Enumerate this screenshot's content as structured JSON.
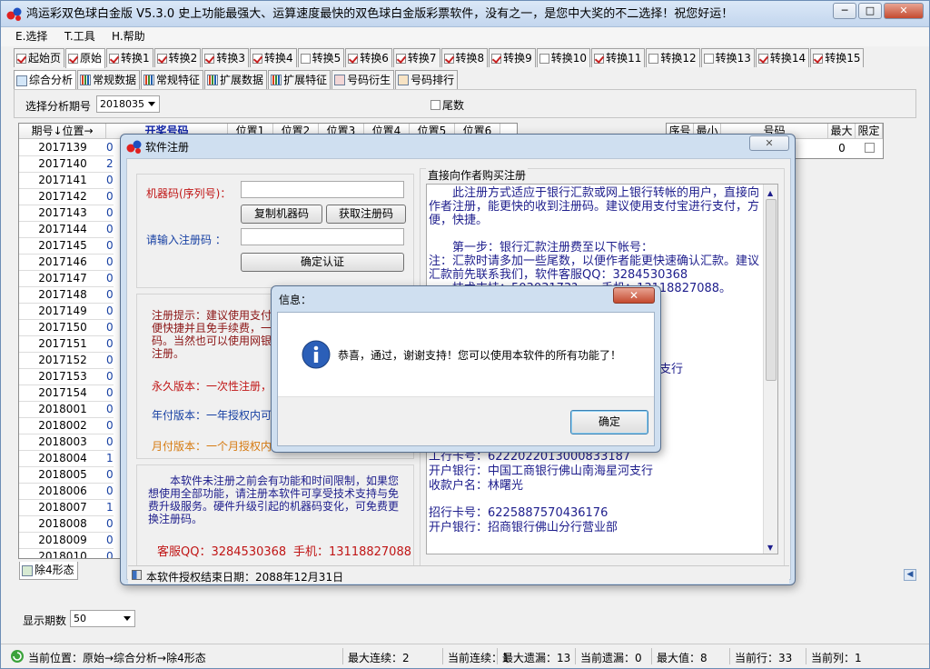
{
  "window": {
    "title": "鸿运彩双色球白金版 V5.3.0  史上功能最强大、运算速度最快的双色球白金版彩票软件，没有之一，是您中大奖的不二选择！祝您好运！"
  },
  "menu": [
    "E.选择",
    "T.工具",
    "H.帮助"
  ],
  "top_tabs": [
    "起始页",
    "原始",
    "转换1",
    "转换2",
    "转换3",
    "转换4",
    "转换5",
    "转换6",
    "转换7",
    "转换8",
    "转换9",
    "转换10",
    "转换11",
    "转换12",
    "转换13",
    "转换14",
    "转换15"
  ],
  "sub_tabs": [
    "综合分析",
    "常规数据",
    "常规特征",
    "扩展数据",
    "扩展特征",
    "号码衍生",
    "号码排行"
  ],
  "filter": {
    "label": "选择分析期号",
    "value": "2018035",
    "tail_label": "尾数"
  },
  "left_grid": {
    "headers": [
      "期号↓位置→",
      "开奖号码",
      "位置1",
      "位置2",
      "位置3",
      "位置4",
      "位置5",
      "位置6"
    ],
    "periods": [
      "2017139",
      "2017140",
      "2017141",
      "2017142",
      "2017143",
      "2017144",
      "2017145",
      "2017146",
      "2017147",
      "2017148",
      "2017149",
      "2017150",
      "2017151",
      "2017152",
      "2017153",
      "2017154",
      "2018001",
      "2018002",
      "2018003",
      "2018004",
      "2018005",
      "2018006",
      "2018007",
      "2018008",
      "2018009",
      "2018010"
    ],
    "second_col": [
      "0",
      "2",
      "0",
      "0",
      "0",
      "0",
      "0",
      "0",
      "0",
      "0",
      "0",
      "0",
      "0",
      "0",
      "0",
      "0",
      "0",
      "0",
      "0",
      "1",
      "0",
      "0",
      "1",
      "0",
      "0",
      "0"
    ]
  },
  "right_grid": {
    "headers": [
      "序号",
      "最小",
      "号码",
      "最大",
      "限定"
    ],
    "row": {
      "max": "0"
    }
  },
  "bottom_tab": "除4形态",
  "display_count": {
    "label": "显示期数",
    "value": "50"
  },
  "status": {
    "location": "当前位置：原始→综合分析→除4形态",
    "max_streak": "最大连续：2",
    "cur_streak": "当前连续：1",
    "max_miss": "最大遗漏：13",
    "cur_miss": "当前遗漏：0",
    "max_val": "最大值：8",
    "cur_row": "当前行：33",
    "cur_col": "当前列：1"
  },
  "reg_dialog": {
    "title": "软件注册",
    "machine_label": "机器码(序列号)：",
    "copy_btn": "复制机器码",
    "get_btn": "获取注册码",
    "code_label": "请输入注册码 ：",
    "confirm_btn": "确定认证",
    "tips1": "注册提示：建议使用支付",
    "tips2": "便快捷并且免手续费，一",
    "tips3": "码。当然也可以使用网银",
    "tips4": "注册。",
    "forever": "永久版本：一次性注册，每",
    "yearly": "年付版本：一年授权内可使",
    "monthly": "月付版本：一个月授权内能",
    "unreg_text": "　　本软件未注册之前会有功能和时间限制，如果您想使用全部功能，请注册本软件可享受技术支持与免费升级服务。硬件升级引起的机器码变化，可免费更换注册码。",
    "qq": "客服QQ：3284530368",
    "phone": "手机：13118827088",
    "buy_title": "直接向作者购买注册",
    "buy_text_top": "　　此注册方式适应于银行汇款或网上银行转帐的用户，直接向作者注册，能更快的收到注册码。建议使用支付宝进行支付，方便，快捷。\n\n　　第一步：银行汇款注册费至以下帐号：\n注：汇款时请多加一些尾数，以便作者能更快速确认汇款。建议汇款前先联系我们，软件客服QQ：3284530368\n　　技术支持：50303173?　　手机：13118827088。",
    "bank_frag": "支行",
    "icbc_card": "工行卡号：6222022013000833187",
    "icbc_bank": "开户银行：中国工商银行佛山南海星河支行",
    "payee": "收款户名：林曙光",
    "cmb_card": "招行卡号：6225887570436176",
    "cmb_bank": "开户银行：招商银行佛山分行营业部",
    "footer": "本软件授权结束日期：2088年12月31日"
  },
  "msg_dialog": {
    "title": "信息：",
    "message": "恭喜，通过，谢谢支持！您可以使用本软件的所有功能了！",
    "ok": "确定"
  }
}
